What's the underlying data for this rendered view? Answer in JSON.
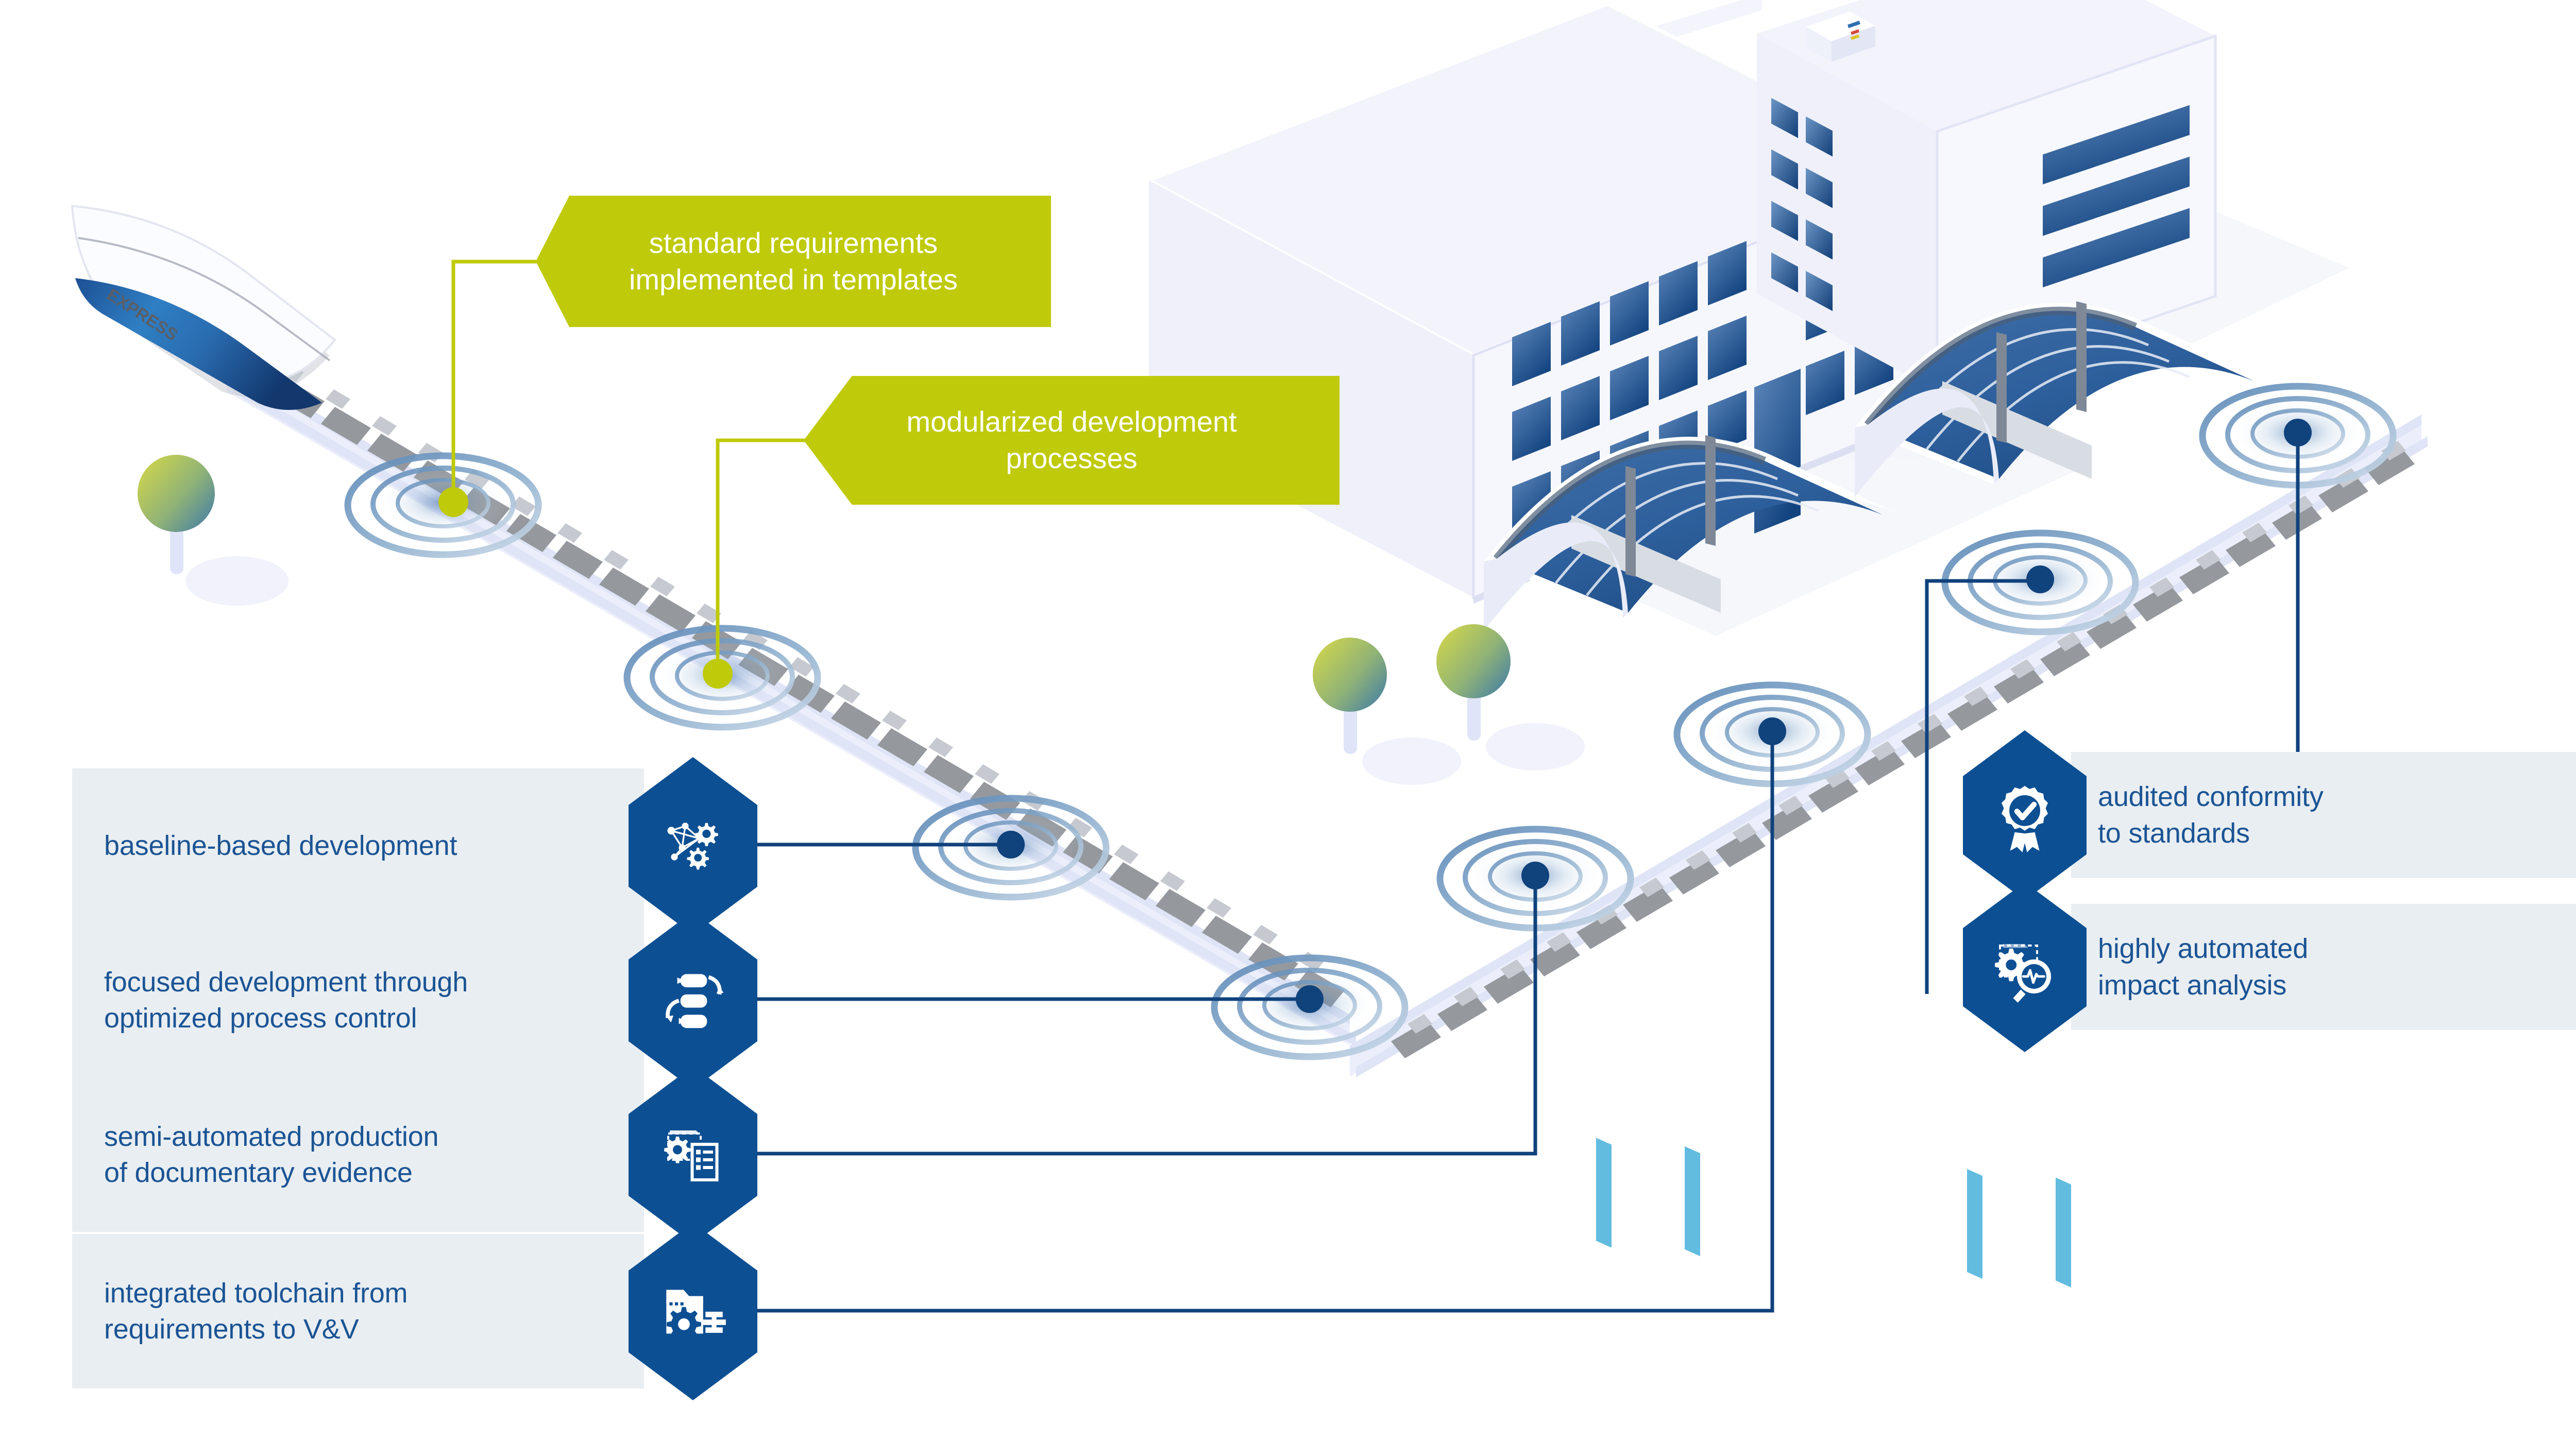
{
  "theme": {
    "brand_blue": "#0d4f93",
    "deep_blue": "#10427c",
    "text_blue": "#1b5494",
    "accent_green": "#bfca0a",
    "bar_grey": "#e9eef2",
    "track_grey": "#8f9296",
    "background": "#ffffff"
  },
  "scene": {
    "train_label": "EXPRESS",
    "train_name": "high-speed-train",
    "buildings": [
      "office-building-large",
      "office-tower",
      "station-canopy-left",
      "station-canopy-right"
    ],
    "trees": [
      "tree-left",
      "tree-middle-1",
      "tree-middle-2"
    ],
    "stations": [
      {
        "name": "station-1",
        "marker": "green"
      },
      {
        "name": "station-2",
        "marker": "green"
      },
      {
        "name": "station-3",
        "marker": "blue"
      },
      {
        "name": "station-4",
        "marker": "blue"
      },
      {
        "name": "station-5",
        "marker": "blue"
      },
      {
        "name": "station-6",
        "marker": "blue"
      },
      {
        "name": "station-7",
        "marker": "blue"
      },
      {
        "name": "station-8",
        "marker": "blue"
      }
    ]
  },
  "callouts": [
    {
      "id": "standard-requirements",
      "text": "standard requirements\nimplemented in templates"
    },
    {
      "id": "modularized-development",
      "text": "modularized development\nprocesses"
    }
  ],
  "left_items": [
    {
      "id": "baseline-based-development",
      "text": "baseline-based development",
      "icon": "network-gears-icon"
    },
    {
      "id": "focused-development",
      "text": "focused development through\noptimized process control",
      "icon": "process-flow-loop-icon"
    },
    {
      "id": "semi-automated-production",
      "text": "semi-automated production\nof documentary evidence",
      "icon": "document-gear-checklist-icon"
    },
    {
      "id": "integrated-toolchain",
      "text": "integrated toolchain from\nrequirements to V&V",
      "icon": "folder-gear-toolchain-icon"
    }
  ],
  "right_items": [
    {
      "id": "audited-conformity",
      "text": "audited conformity\nto standards",
      "icon": "award-ribbon-check-icon"
    },
    {
      "id": "highly-automated-impact-analysis",
      "text": "highly automated\nimpact analysis",
      "icon": "gear-magnifier-pulse-icon"
    }
  ]
}
